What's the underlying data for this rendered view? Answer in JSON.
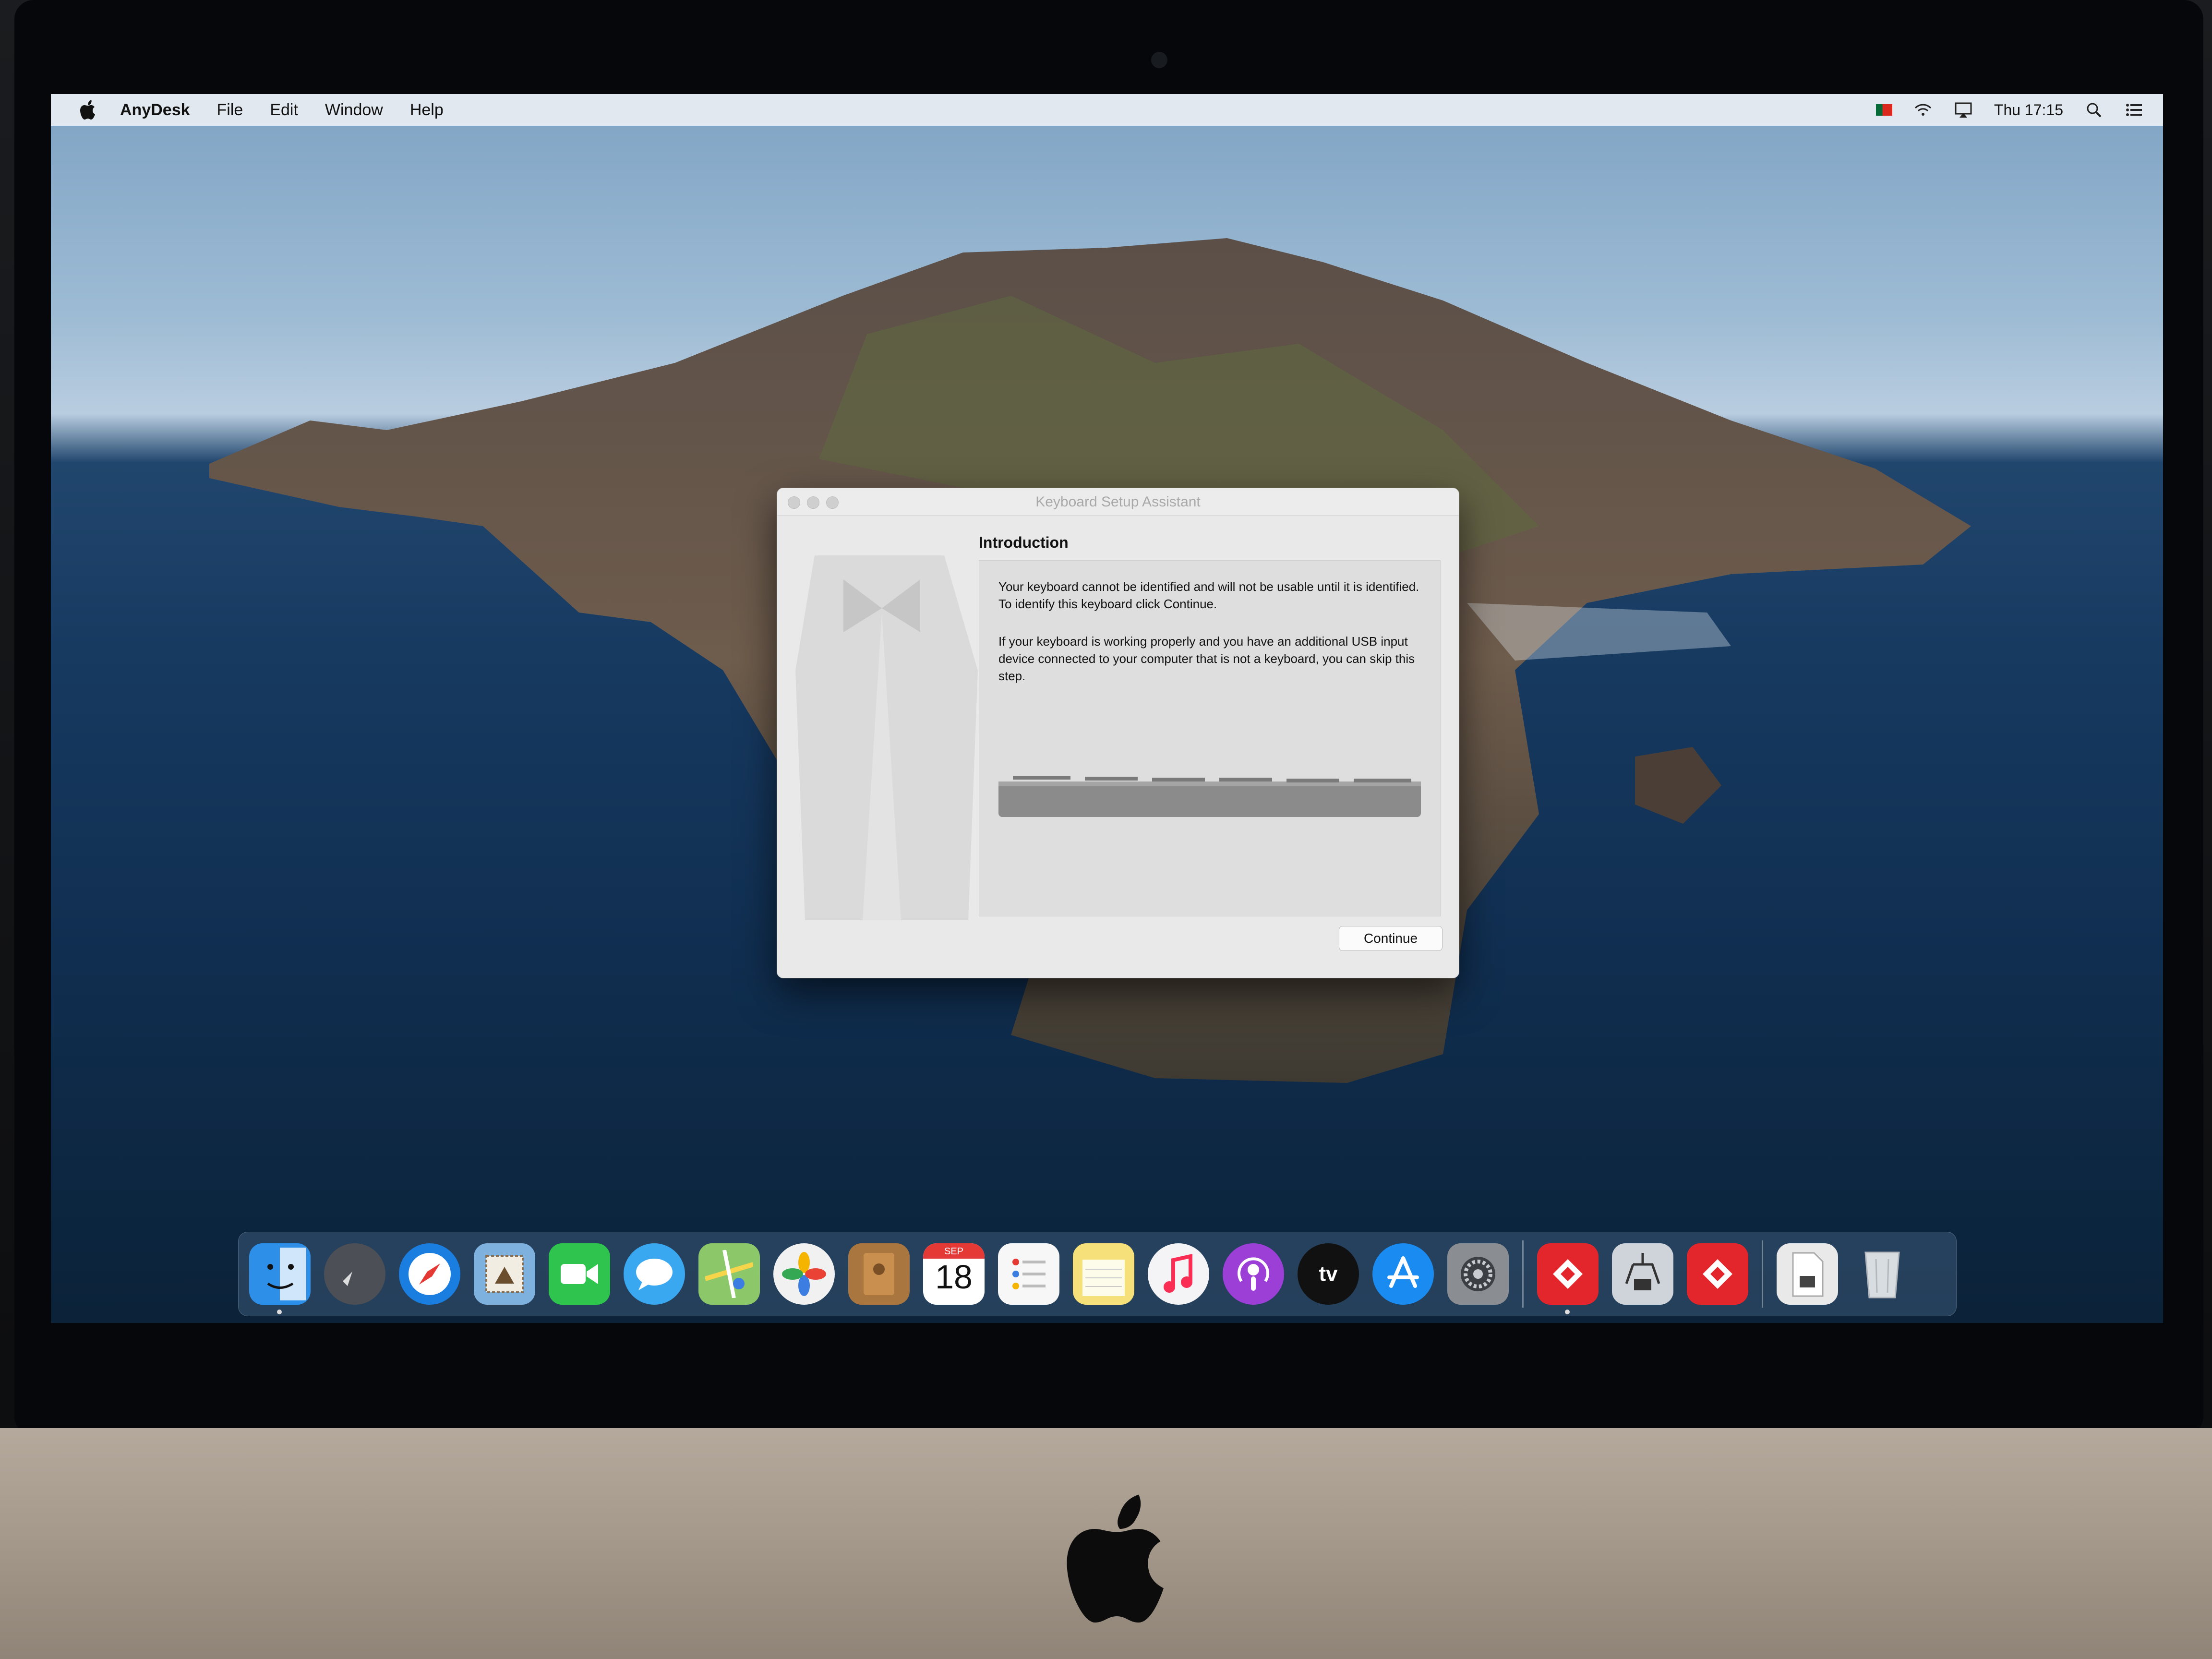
{
  "menubar": {
    "app_name": "AnyDesk",
    "items": [
      "File",
      "Edit",
      "Window",
      "Help"
    ],
    "clock": "Thu 17:15"
  },
  "dialog": {
    "title": "Keyboard Setup Assistant",
    "heading": "Introduction",
    "paragraph1": "Your keyboard cannot be identified and will not be usable until it is identified. To identify this keyboard click Continue.",
    "paragraph2": "If your keyboard is working properly and you have an additional USB input device connected to your computer that is not a keyboard, you can skip this step.",
    "continue_label": "Continue"
  },
  "dock": {
    "items": [
      {
        "name": "finder",
        "icon": "finder-icon",
        "color": "#2e8fe8",
        "running": true
      },
      {
        "name": "launchpad",
        "icon": "rocket-icon",
        "color": "#4c4f55",
        "running": false
      },
      {
        "name": "safari",
        "icon": "compass-icon",
        "color": "#1a7de0",
        "running": false
      },
      {
        "name": "mail",
        "icon": "stamp-icon",
        "color": "#7fb1df",
        "running": false
      },
      {
        "name": "facetime",
        "icon": "video-camera-icon",
        "color": "#2fc44d",
        "running": false
      },
      {
        "name": "messages",
        "icon": "speech-bubble-icon",
        "color": "#3aa8f0",
        "running": false
      },
      {
        "name": "maps",
        "icon": "map-icon",
        "color": "#8cc76a",
        "running": false
      },
      {
        "name": "photos",
        "icon": "flower-icon",
        "color": "#f1f1f1",
        "running": false
      },
      {
        "name": "contacts",
        "icon": "address-book-icon",
        "color": "#a9763f",
        "running": false
      },
      {
        "name": "calendar",
        "icon": "calendar-icon",
        "color": "#ffffff",
        "running": false
      },
      {
        "name": "reminders",
        "icon": "checklist-icon",
        "color": "#f7f7f7",
        "running": false
      },
      {
        "name": "notes",
        "icon": "notepad-icon",
        "color": "#f6e07a",
        "running": false
      },
      {
        "name": "music",
        "icon": "music-note-icon",
        "color": "#f4f4f6",
        "running": false
      },
      {
        "name": "podcasts",
        "icon": "podcast-icon",
        "color": "#9b3fd6",
        "running": false
      },
      {
        "name": "tv",
        "icon": "tv-icon",
        "color": "#111111",
        "running": false
      },
      {
        "name": "app-store",
        "icon": "app-store-icon",
        "color": "#1a8cf1",
        "running": false
      },
      {
        "name": "system-preferences",
        "icon": "gear-icon",
        "color": "#8a8d92",
        "running": false
      }
    ],
    "calendar": {
      "month": "SEP",
      "day": "18"
    },
    "tv_label": "tv",
    "extra_items": [
      {
        "name": "anydesk",
        "icon": "anydesk-icon",
        "color": "#e3262b",
        "running": true
      },
      {
        "name": "system-information",
        "icon": "chip-clamp-icon",
        "color": "#cfd4da",
        "running": false
      },
      {
        "name": "anydesk-2",
        "icon": "anydesk-icon",
        "color": "#e3262b",
        "running": false
      },
      {
        "name": "documents",
        "icon": "document-icon",
        "color": "#e9e9e9",
        "running": false
      },
      {
        "name": "trash",
        "icon": "trash-icon",
        "color": "#d8dde2",
        "running": false
      }
    ]
  }
}
